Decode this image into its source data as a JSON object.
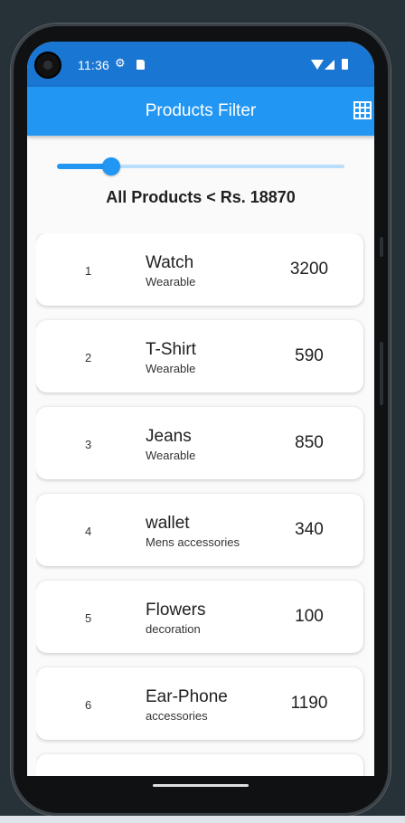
{
  "status_bar": {
    "time": "11:36",
    "icons": [
      "settings-sync-icon",
      "sd-card-icon",
      "wifi-icon",
      "cell-signal-icon",
      "battery-icon"
    ]
  },
  "app_bar": {
    "title": "Products Filter",
    "action_icon": "grid-view-icon",
    "color": "#2196F3",
    "status_color": "#1976D2"
  },
  "slider": {
    "value_fraction": 0.19,
    "active_color": "#2196F3",
    "inactive_color": "#BBDEFB"
  },
  "filter_label": "All Products < Rs. 18870",
  "products": [
    {
      "index": "1",
      "name": "Watch",
      "category": "Wearable",
      "price": "3200"
    },
    {
      "index": "2",
      "name": "T-Shirt",
      "category": "Wearable",
      "price": "590"
    },
    {
      "index": "3",
      "name": "Jeans",
      "category": "Wearable",
      "price": "850"
    },
    {
      "index": "4",
      "name": "wallet",
      "category": "Mens accessories",
      "price": "340"
    },
    {
      "index": "5",
      "name": "Flowers",
      "category": "decoration",
      "price": "100"
    },
    {
      "index": "6",
      "name": "Ear-Phone",
      "category": "accessories",
      "price": "1190"
    }
  ]
}
